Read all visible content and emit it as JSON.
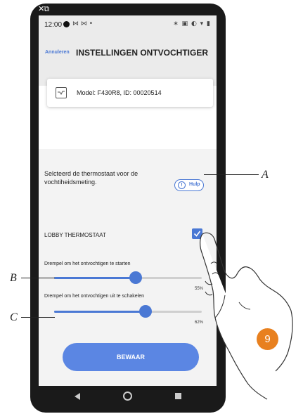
{
  "status_bar": {
    "time": "12:00",
    "left_icons": "⋈ ⋈ •",
    "right_icons": "∗ ▣ ◐ ▾ ▮"
  },
  "header": {
    "cancel_label": "Annuleren",
    "title": "INSTELLINGEN ONTVOCHTIGER"
  },
  "device": {
    "model_text": "Model: F430R8, ID: 00020514"
  },
  "description": "Selcteerd de thermostaat voor de vochtiheidsmeting.",
  "help_button": {
    "icon_text": "!",
    "label": "Hulp"
  },
  "thermostat": {
    "label": "LOBBY THERMOSTAAT",
    "checked": true
  },
  "sliders": [
    {
      "label": "Drempel om het ontvochtigen te starten",
      "value": 55,
      "value_text": "55%"
    },
    {
      "label": "Drempel om het ontvochtigen uit te schakelen",
      "value": 62,
      "value_text": "62%"
    }
  ],
  "save_button": {
    "label": "BEWAAR"
  },
  "callouts": {
    "a": "A",
    "b": "B",
    "c": "C"
  },
  "step_badge": "9",
  "colors": {
    "accent": "#4a78d4",
    "save_button": "#5b86e3",
    "step_badge": "#e8801f",
    "header_bg": "#ebebeb"
  }
}
